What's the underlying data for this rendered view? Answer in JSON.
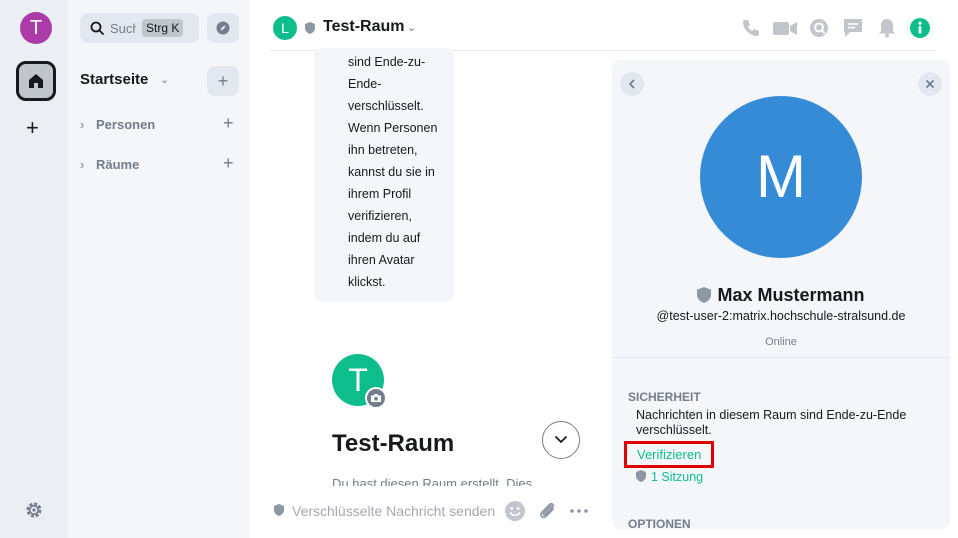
{
  "space_panel": {
    "user_initial": "T",
    "user_avatar_color": "#ac3ba8",
    "home_icon": "home-icon",
    "add_space_label": "+",
    "settings_icon": "gear-icon"
  },
  "room_list": {
    "search_placeholder": "Suche",
    "search_shortcut": "Strg K",
    "explore_icon": "compass-icon",
    "home_title": "Startseite",
    "home_add_label": "+",
    "sections": [
      {
        "label": "Personen"
      },
      {
        "label": "Räume"
      }
    ]
  },
  "header": {
    "room_initial": "L",
    "room_name": "Test-Raum",
    "icons": [
      "phone-icon",
      "video-icon",
      "threads-icon",
      "chat-icon",
      "bell-icon",
      "info-icon"
    ]
  },
  "timeline": {
    "bubble_lines": [
      "sind Ende-zu-",
      "Ende-",
      "verschlüsselt.",
      "Wenn Personen",
      "ihn betreten,",
      "kannst du sie in",
      "ihrem Profil",
      "verifizieren,",
      "indem du auf",
      "ihren Avatar",
      "klickst."
    ],
    "room_initial": "T",
    "room_title": "Test-Raum",
    "intro_text": "Du hast diesen Raum erstellt. Dies",
    "composer_placeholder": "Verschlüsselte Nachricht senden…"
  },
  "right_panel": {
    "avatar_initial": "M",
    "avatar_color": "#368bd6",
    "name": "Max Mustermann",
    "user_id": "@test-user-2:matrix.hochschule-stralsund.de",
    "presence": "Online",
    "security_header": "SICHERHEIT",
    "security_desc": "Nachrichten in diesem Raum sind Ende-zu-Ende verschlüsselt.",
    "verify_label": "Verifizieren",
    "sessions_label": "1 Sitzung",
    "options_header": "OPTIONEN"
  },
  "colors": {
    "accent": "#0dbd8b",
    "highlight_border": "#e00000"
  }
}
